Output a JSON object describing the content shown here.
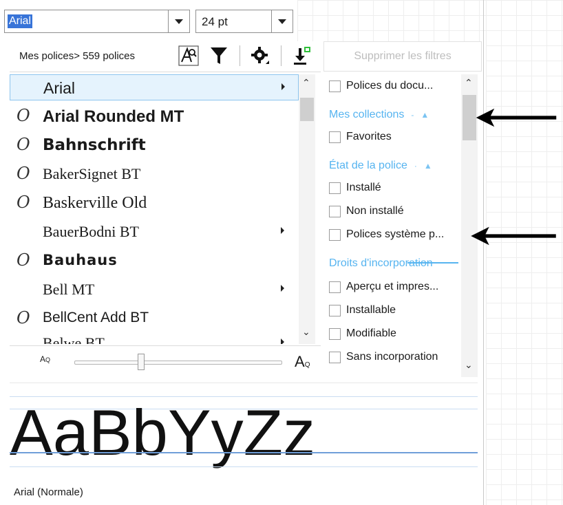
{
  "font_combo": {
    "value": "Arial"
  },
  "size_combo": {
    "value": "24 pt"
  },
  "toolbar": {
    "my_fonts_label": "Mes polices> 559 polices",
    "clear_filters_label": "Supprimer les filtres"
  },
  "font_list": [
    {
      "name": "Arial",
      "has_submenu": true,
      "opentype": false,
      "selected": true
    },
    {
      "name": "Arial Rounded MT",
      "has_submenu": false,
      "opentype": true
    },
    {
      "name": "Bahnschrift",
      "has_submenu": false,
      "opentype": true
    },
    {
      "name": "BakerSignet BT",
      "has_submenu": false,
      "opentype": true
    },
    {
      "name": "Baskerville Old",
      "has_submenu": false,
      "opentype": true
    },
    {
      "name": "BauerBodni BT",
      "has_submenu": true,
      "opentype": false
    },
    {
      "name": "Bauhaus",
      "has_submenu": false,
      "opentype": true
    },
    {
      "name": "Bell MT",
      "has_submenu": true,
      "opentype": false
    },
    {
      "name": "BellCent Add BT",
      "has_submenu": false,
      "opentype": true
    },
    {
      "name": "Belwe BT",
      "has_submenu": true,
      "opentype": false
    }
  ],
  "filters": {
    "document_fonts": "Polices du docu...",
    "collections_header": "Mes collections",
    "favorites": "Favorites",
    "state_header": "État de la police",
    "installed": "Installé",
    "not_installed": "Non installé",
    "system_fonts": "Polices système p...",
    "embedding_header": "Droits d'incorporation",
    "preview_print": "Aperçu et impres...",
    "installable": "Installable",
    "editable": "Modifiable",
    "no_embedding": "Sans incorporation"
  },
  "preview": {
    "sample": "AaBbYyZz",
    "style_label": "Arial (Normale)"
  },
  "colors": {
    "selection": "#3874d8",
    "accent": "#56b4f0",
    "list_highlight": "#e5f3fd"
  }
}
